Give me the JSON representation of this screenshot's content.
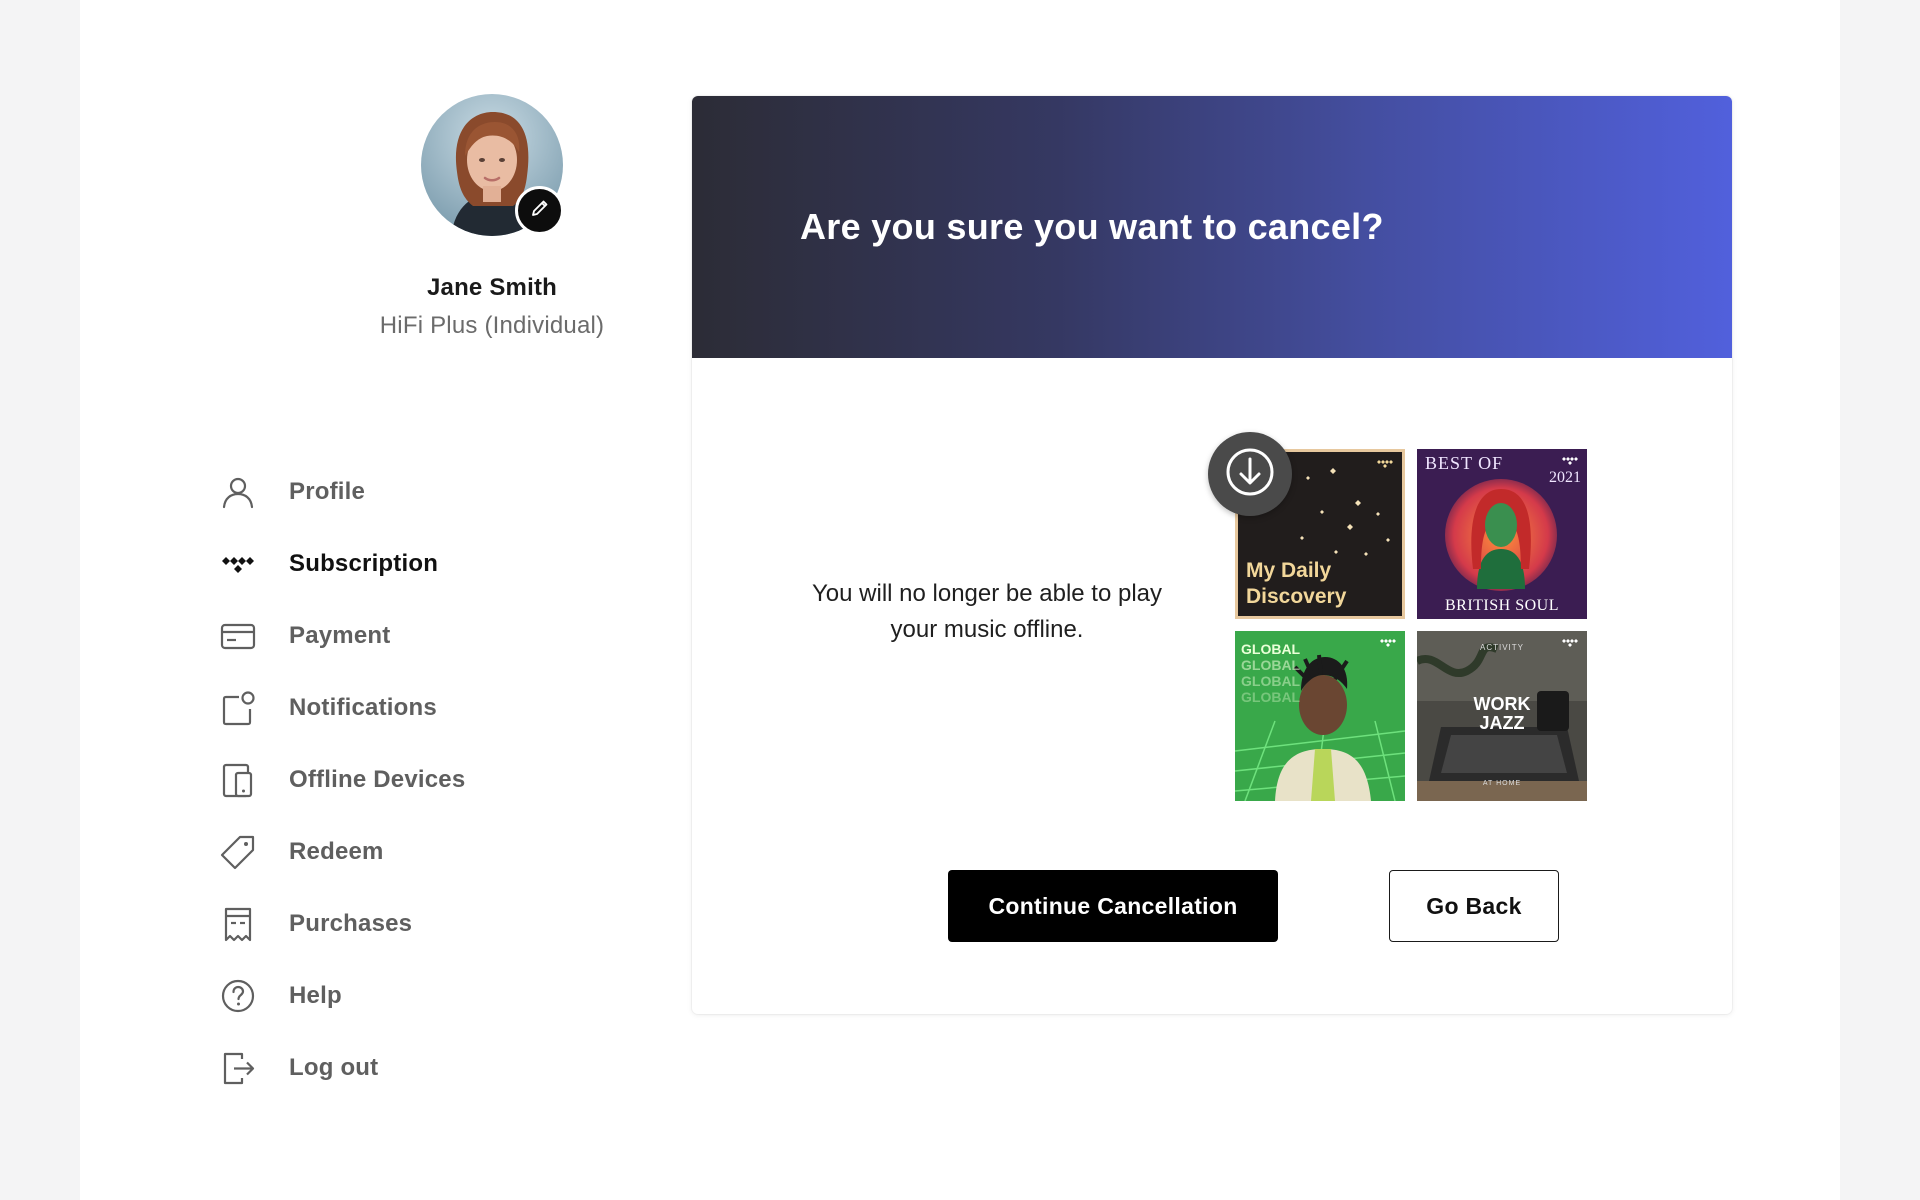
{
  "user": {
    "name": "Jane Smith",
    "plan": "HiFi Plus (Individual)",
    "avatar_icon": "user-photo",
    "edit_icon": "pencil-icon"
  },
  "nav": {
    "items": [
      {
        "label": "Profile",
        "icon": "person-icon"
      },
      {
        "label": "Subscription",
        "icon": "tidal-logo-icon",
        "active": true
      },
      {
        "label": "Payment",
        "icon": "credit-card-icon"
      },
      {
        "label": "Notifications",
        "icon": "notification-icon"
      },
      {
        "label": "Offline Devices",
        "icon": "devices-icon"
      },
      {
        "label": "Redeem",
        "icon": "tag-icon"
      },
      {
        "label": "Purchases",
        "icon": "receipt-icon"
      },
      {
        "label": "Help",
        "icon": "help-icon"
      },
      {
        "label": "Log out",
        "icon": "logout-icon"
      }
    ]
  },
  "card": {
    "title": "Are you sure you want to cancel?",
    "message": "You will no longer be able to play your music offline.",
    "header_colors": [
      "#2c2c36",
      "#5160dc"
    ],
    "download_icon": "download-icon",
    "playlists": [
      {
        "title_line1": "My Daily",
        "title_line2": "Discovery"
      },
      {
        "top": "BEST OF",
        "year": "2021",
        "bottom": "BRITISH SOUL"
      },
      {
        "lines": [
          "GLOBAL",
          "GLOBAL",
          "GLOBAL",
          "GLOBAL"
        ]
      },
      {
        "kicker": "ACTIVITY",
        "line1": "WORK",
        "line2": "JAZZ",
        "footer": "AT HOME"
      }
    ],
    "continue_label": "Continue Cancellation",
    "back_label": "Go Back"
  }
}
